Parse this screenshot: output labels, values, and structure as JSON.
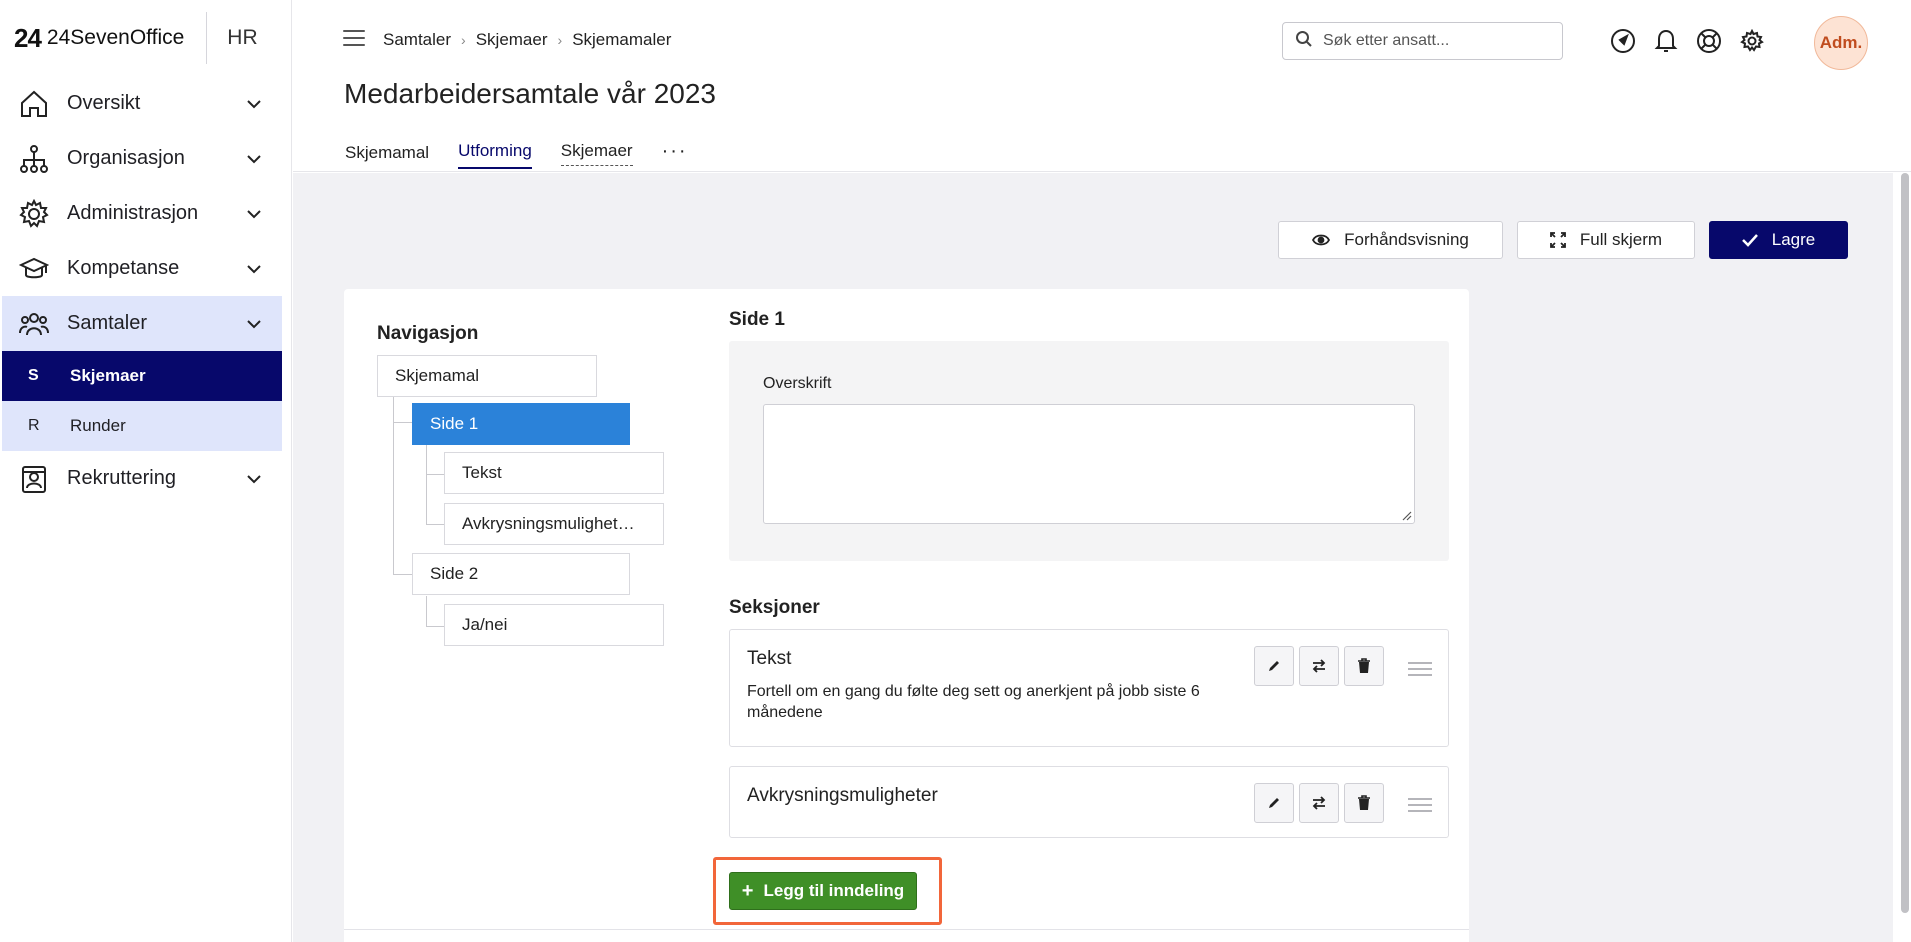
{
  "brand": {
    "logo": "24",
    "name": "24SevenOffice",
    "module": "HR"
  },
  "sidebar": {
    "items": [
      {
        "label": "Oversikt",
        "icon": "home-icon"
      },
      {
        "label": "Organisasjon",
        "icon": "org-chart-icon"
      },
      {
        "label": "Administrasjon",
        "icon": "gear-icon"
      },
      {
        "label": "Kompetanse",
        "icon": "graduation-cap-icon"
      },
      {
        "label": "Samtaler",
        "icon": "people-icon",
        "open": true
      },
      {
        "label": "Rekruttering",
        "icon": "id-badge-icon"
      }
    ],
    "subitems": [
      {
        "letter": "S",
        "label": "Skjemaer",
        "active": true
      },
      {
        "letter": "R",
        "label": "Runder"
      }
    ]
  },
  "breadcrumb": [
    "Samtaler",
    "Skjemaer",
    "Skjemamaler"
  ],
  "page_title": "Medarbeidersamtale vår 2023",
  "tabs": [
    {
      "label": "Skjemamal"
    },
    {
      "label": "Utforming",
      "active": true
    },
    {
      "label": "Skjemaer"
    },
    {
      "label": "···"
    }
  ],
  "search": {
    "placeholder": "Søk etter ansatt..."
  },
  "user": {
    "avatar": "Adm."
  },
  "toolbar": {
    "preview": "Forhåndsvisning",
    "fullscreen": "Full skjerm",
    "save": "Lagre"
  },
  "navigation": {
    "title": "Navigasjon",
    "root": "Skjemamal",
    "pages": [
      {
        "label": "Side 1",
        "selected": true,
        "children": [
          "Tekst",
          "Avkrysningsmulighet…"
        ]
      },
      {
        "label": "Side 2",
        "children": [
          "Ja/nei"
        ]
      }
    ]
  },
  "editor": {
    "page_title": "Side 1",
    "header_label": "Overskrift",
    "header_value": "",
    "sections_title": "Seksjoner",
    "sections": [
      {
        "title": "Tekst",
        "description": "Fortell om en gang du følte deg sett og anerkjent på jobb siste 6 månedene"
      },
      {
        "title": "Avkrysningsmuligheter",
        "description": ""
      }
    ],
    "add_button": "Legg til inndeling"
  },
  "colors": {
    "primary": "#07086b",
    "selected_node": "#2b82d9",
    "add_button": "#3f8f27",
    "highlight": "#f2663a",
    "sidebar_open": "#dfe5fb"
  }
}
